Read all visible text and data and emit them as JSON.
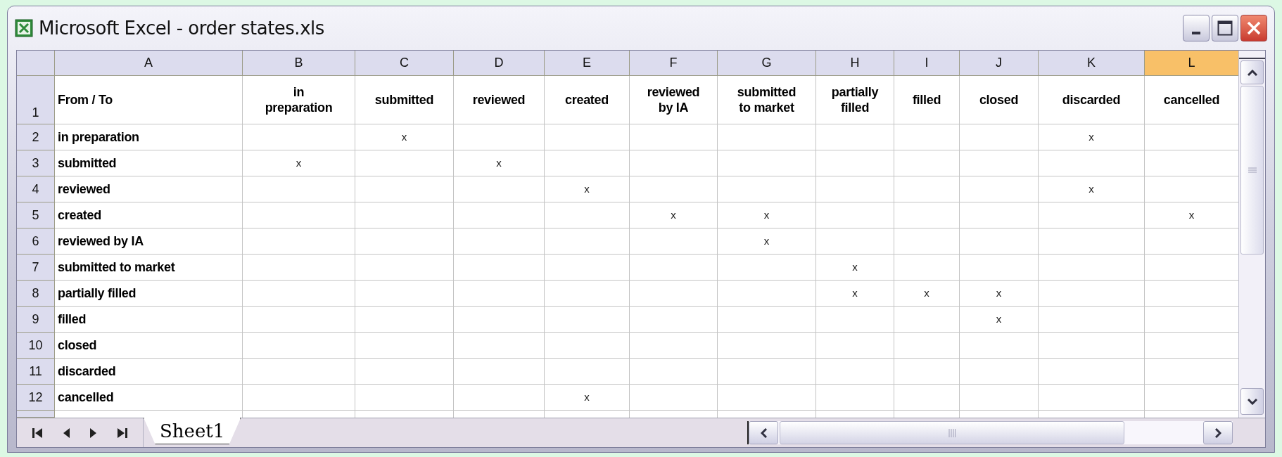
{
  "window": {
    "title": "Microsoft Excel - order states.xls"
  },
  "columns": [
    {
      "letter": "A",
      "selected": false
    },
    {
      "letter": "B",
      "selected": false
    },
    {
      "letter": "C",
      "selected": false
    },
    {
      "letter": "D",
      "selected": false
    },
    {
      "letter": "E",
      "selected": false
    },
    {
      "letter": "F",
      "selected": false
    },
    {
      "letter": "G",
      "selected": false
    },
    {
      "letter": "H",
      "selected": false
    },
    {
      "letter": "I",
      "selected": false
    },
    {
      "letter": "J",
      "selected": false
    },
    {
      "letter": "K",
      "selected": false
    },
    {
      "letter": "L",
      "selected": true
    }
  ],
  "header_row": {
    "row_number": "1",
    "cells": [
      "From / To",
      "in\npreparation",
      "submitted",
      "reviewed",
      "created",
      "reviewed\nby IA",
      "submitted\nto market",
      "partially\nfilled",
      "filled",
      "closed",
      "discarded",
      "cancelled"
    ]
  },
  "rows": [
    {
      "row_number": "2",
      "label": "in preparation",
      "marks": [
        {
          "kind": "blank"
        },
        {
          "kind": "mark",
          "text": "x"
        },
        {
          "kind": "blank"
        },
        {
          "kind": "blank"
        },
        {
          "kind": "blank"
        },
        {
          "kind": "blank"
        },
        {
          "kind": "blank"
        },
        {
          "kind": "blank"
        },
        {
          "kind": "blank"
        },
        {
          "kind": "mark",
          "text": "x"
        },
        {
          "kind": "blank"
        }
      ]
    },
    {
      "row_number": "3",
      "label": "submitted",
      "marks": [
        {
          "kind": "mark",
          "text": "x"
        },
        {
          "kind": "blank"
        },
        {
          "kind": "mark",
          "text": "x"
        },
        {
          "kind": "blank"
        },
        {
          "kind": "blank"
        },
        {
          "kind": "blank"
        },
        {
          "kind": "blank"
        },
        {
          "kind": "blank"
        },
        {
          "kind": "blank"
        },
        {
          "kind": "blank"
        },
        {
          "kind": "blank"
        }
      ]
    },
    {
      "row_number": "4",
      "label": "reviewed",
      "marks": [
        {
          "kind": "blank"
        },
        {
          "kind": "blank"
        },
        {
          "kind": "blank"
        },
        {
          "kind": "mark",
          "text": "x"
        },
        {
          "kind": "blank"
        },
        {
          "kind": "blank"
        },
        {
          "kind": "blank"
        },
        {
          "kind": "blank"
        },
        {
          "kind": "blank"
        },
        {
          "kind": "mark",
          "text": "x"
        },
        {
          "kind": "blank"
        }
      ]
    },
    {
      "row_number": "5",
      "label": "created",
      "marks": [
        {
          "kind": "blank"
        },
        {
          "kind": "blank"
        },
        {
          "kind": "blank"
        },
        {
          "kind": "blank"
        },
        {
          "kind": "mark",
          "text": "x"
        },
        {
          "kind": "mark",
          "text": "x"
        },
        {
          "kind": "blank"
        },
        {
          "kind": "blank"
        },
        {
          "kind": "blank"
        },
        {
          "kind": "blank"
        },
        {
          "kind": "mark",
          "text": "x"
        }
      ]
    },
    {
      "row_number": "6",
      "label": "reviewed by IA",
      "marks": [
        {
          "kind": "blank"
        },
        {
          "kind": "blank"
        },
        {
          "kind": "blank"
        },
        {
          "kind": "blank"
        },
        {
          "kind": "blank"
        },
        {
          "kind": "mark",
          "text": "x"
        },
        {
          "kind": "blank"
        },
        {
          "kind": "blank"
        },
        {
          "kind": "blank"
        },
        {
          "kind": "blank"
        },
        {
          "kind": "blank"
        }
      ]
    },
    {
      "row_number": "7",
      "label": "submitted to market",
      "marks": [
        {
          "kind": "blank"
        },
        {
          "kind": "blank"
        },
        {
          "kind": "blank"
        },
        {
          "kind": "blank"
        },
        {
          "kind": "blank"
        },
        {
          "kind": "blank"
        },
        {
          "kind": "mark",
          "text": "x"
        },
        {
          "kind": "blank"
        },
        {
          "kind": "blank"
        },
        {
          "kind": "blank"
        },
        {
          "kind": "blank"
        }
      ]
    },
    {
      "row_number": "8",
      "label": "partially filled",
      "marks": [
        {
          "kind": "blank"
        },
        {
          "kind": "blank"
        },
        {
          "kind": "blank"
        },
        {
          "kind": "blank"
        },
        {
          "kind": "blank"
        },
        {
          "kind": "blank"
        },
        {
          "kind": "mark",
          "text": "x"
        },
        {
          "kind": "mark",
          "text": "x"
        },
        {
          "kind": "mark",
          "text": "x"
        },
        {
          "kind": "blank"
        },
        {
          "kind": "blank"
        }
      ]
    },
    {
      "row_number": "9",
      "label": "filled",
      "marks": [
        {
          "kind": "blank"
        },
        {
          "kind": "blank"
        },
        {
          "kind": "blank"
        },
        {
          "kind": "blank"
        },
        {
          "kind": "blank"
        },
        {
          "kind": "blank"
        },
        {
          "kind": "blank"
        },
        {
          "kind": "blank"
        },
        {
          "kind": "mark",
          "text": "x"
        },
        {
          "kind": "blank"
        },
        {
          "kind": "blank"
        }
      ]
    },
    {
      "row_number": "10",
      "label": "closed",
      "marks": [
        {
          "kind": "blank"
        },
        {
          "kind": "blank"
        },
        {
          "kind": "blank"
        },
        {
          "kind": "blank"
        },
        {
          "kind": "blank"
        },
        {
          "kind": "blank"
        },
        {
          "kind": "blank"
        },
        {
          "kind": "blank"
        },
        {
          "kind": "blank"
        },
        {
          "kind": "blank"
        },
        {
          "kind": "blank"
        }
      ]
    },
    {
      "row_number": "11",
      "label": "discarded",
      "marks": [
        {
          "kind": "blank"
        },
        {
          "kind": "blank"
        },
        {
          "kind": "blank"
        },
        {
          "kind": "blank"
        },
        {
          "kind": "blank"
        },
        {
          "kind": "blank"
        },
        {
          "kind": "blank"
        },
        {
          "kind": "blank"
        },
        {
          "kind": "blank"
        },
        {
          "kind": "blank"
        },
        {
          "kind": "blank"
        }
      ]
    },
    {
      "row_number": "12",
      "label": "cancelled",
      "marks": [
        {
          "kind": "blank"
        },
        {
          "kind": "blank"
        },
        {
          "kind": "blank"
        },
        {
          "kind": "mark",
          "text": "x"
        },
        {
          "kind": "blank"
        },
        {
          "kind": "blank"
        },
        {
          "kind": "blank"
        },
        {
          "kind": "blank"
        },
        {
          "kind": "blank"
        },
        {
          "kind": "blank"
        },
        {
          "kind": "blank"
        }
      ]
    }
  ],
  "sheet_tabs": [
    {
      "label": "Sheet1",
      "selected": true
    }
  ]
}
